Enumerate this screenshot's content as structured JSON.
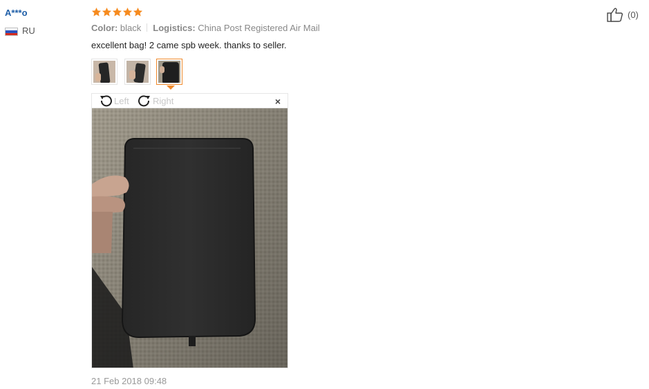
{
  "review": {
    "user": "A***o",
    "country": "RU",
    "rating": 5,
    "max_rating": 5,
    "color_label": "Color:",
    "color_value": "black",
    "logistics_label": "Logistics:",
    "logistics_value": "China Post Registered Air Mail",
    "text": "excellent bag! 2 came spb week. thanks to seller.",
    "date": "21 Feb 2018 09:48",
    "helpful_count": "(0)"
  },
  "viewer": {
    "rotate_left": "Left",
    "rotate_right": "Right",
    "close": "×"
  },
  "thumbnails": [
    {
      "name": "photo-1",
      "active": false
    },
    {
      "name": "photo-2",
      "active": false
    },
    {
      "name": "photo-3",
      "active": true
    }
  ],
  "colors": {
    "username": "#1f5fa8",
    "star": "#f68b1f",
    "active_border": "#f08a2c"
  }
}
